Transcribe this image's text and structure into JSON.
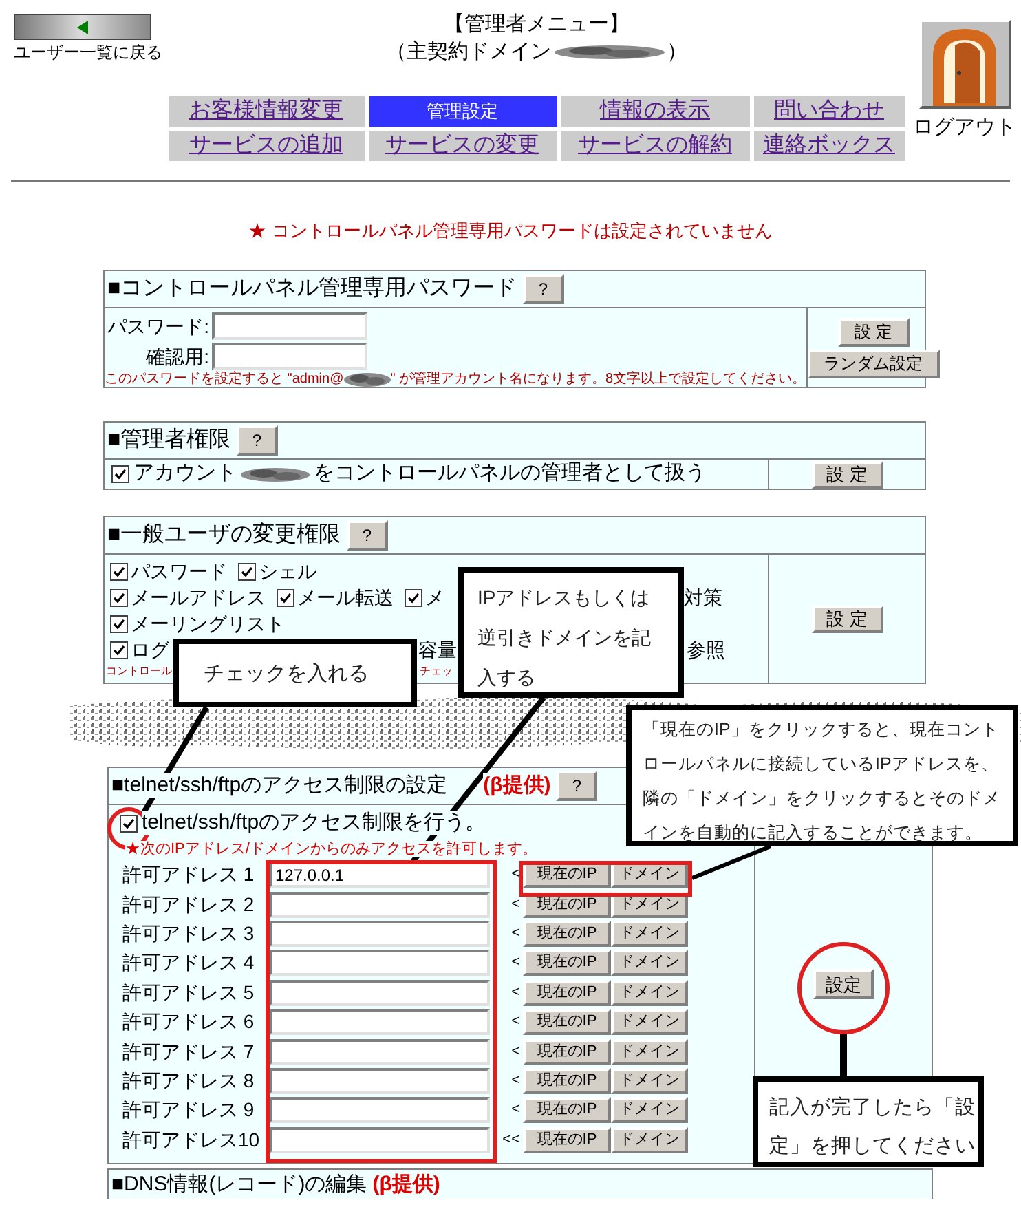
{
  "header": {
    "back_label": "ユーザー一覧に戻る",
    "title": "【管理者メニュー】",
    "subtitle_prefix": "（主契約ドメイン",
    "subtitle_suffix": "）",
    "logout_label": "ログアウト"
  },
  "nav": [
    {
      "label": "お客様情報変更",
      "selected": false
    },
    {
      "label": "管理設定",
      "selected": true
    },
    {
      "label": "情報の表示",
      "selected": false
    },
    {
      "label": "問い合わせ",
      "selected": false
    },
    {
      "label": "サービスの追加",
      "selected": false
    },
    {
      "label": "サービスの変更",
      "selected": false
    },
    {
      "label": "サービスの解約",
      "selected": false
    },
    {
      "label": "連絡ボックス",
      "selected": false
    }
  ],
  "notice": "★ コントロールパネル管理専用パスワードは設定されていません",
  "password_section": {
    "title": "■コントロールパネル管理専用パスワード",
    "help": "?",
    "fields": [
      {
        "label": "パスワード:"
      },
      {
        "label": "確認用:"
      }
    ],
    "note_prefix": "このパスワードを設定すると \"admin@",
    "note_suffix": "\" が管理アカウント名になります。8文字以上で設定してください。",
    "buttons": [
      "設 定",
      "ランダム設定"
    ]
  },
  "admin_section": {
    "title": "■管理者権限",
    "help": "?",
    "checked": true,
    "label_prefix": "アカウント",
    "label_suffix": "をコントロールパネルの管理者として扱う",
    "button": "設 定"
  },
  "user_section": {
    "title": "■一般ユーザの変更権限",
    "help": "?",
    "lines": [
      {
        "items": [
          {
            "kind": "checkbox",
            "label": "パスワード",
            "checked": true
          },
          {
            "kind": "checkbox",
            "label": "シェル",
            "checked": true
          }
        ]
      },
      {
        "items": [
          {
            "kind": "checkbox",
            "label": "メールアドレス",
            "checked": true
          },
          {
            "kind": "checkbox",
            "label": "メール転送",
            "checked": true
          },
          {
            "kind": "checkbox",
            "label": "メ",
            "checked": true
          },
          {
            "kind": "text",
            "label": "対策"
          }
        ]
      },
      {
        "items": [
          {
            "kind": "checkbox",
            "label": "メーリングリスト",
            "checked": true
          }
        ]
      },
      {
        "items": [
          {
            "kind": "checkbox",
            "label": "ログ",
            "checked": true
          },
          {
            "kind": "text",
            "label": "容量"
          },
          {
            "kind": "text",
            "label": "参照"
          }
        ]
      }
    ],
    "note": [
      {
        "text": "コントロール"
      },
      {
        "text": "チェッ"
      }
    ],
    "button": "設 定"
  },
  "access_section": {
    "title": "■telnet/ssh/ftpのアクセス制限の設定",
    "tag": "(β提供)",
    "help": "?",
    "enable": {
      "label": "telnet/ssh/ftpのアクセス制限を行う。",
      "checked": true
    },
    "note": "★次のIPアドレス/ドメインからのみアクセスを許可します。",
    "rows": [
      {
        "label": "許可アドレス 1",
        "value": "127.0.0.1",
        "arrow": "<",
        "ip_button": "現在のIP",
        "domain_button": "ドメイン"
      },
      {
        "label": "許可アドレス 2",
        "arrow": "<",
        "ip_button": "現在のIP",
        "domain_button": "ドメイン"
      },
      {
        "label": "許可アドレス 3",
        "arrow": "<",
        "ip_button": "現在のIP",
        "domain_button": "ドメイン"
      },
      {
        "label": "許可アドレス 4",
        "arrow": "<",
        "ip_button": "現在のIP",
        "domain_button": "ドメイン"
      },
      {
        "label": "許可アドレス 5",
        "arrow": "<",
        "ip_button": "現在のIP",
        "domain_button": "ドメイン"
      },
      {
        "label": "許可アドレス 6",
        "arrow": "<",
        "ip_button": "現在のIP",
        "domain_button": "ドメイン"
      },
      {
        "label": "許可アドレス 7",
        "arrow": "<",
        "ip_button": "現在のIP",
        "domain_button": "ドメイン"
      },
      {
        "label": "許可アドレス 8",
        "arrow": "<",
        "ip_button": "現在のIP",
        "domain_button": "ドメイン"
      },
      {
        "label": "許可アドレス 9",
        "arrow": "<",
        "ip_button": "現在のIP",
        "domain_button": "ドメイン"
      },
      {
        "label": "許可アドレス10",
        "arrow": "<<",
        "ip_button": "現在のIP",
        "domain_button": "ドメイン"
      }
    ],
    "button": "設定"
  },
  "dns_section": {
    "title": "■DNS情報(レコード)の編集",
    "tag": "(β提供)"
  },
  "callouts": [
    {
      "text": "チェックを入れる"
    },
    {
      "text": "IPアドレスもしくは逆引きドメインを記入する"
    },
    {
      "text": "「現在のIP」をクリックすると、現在コントロールパネルに接続しているIPアドレスを、隣の「ドメイン」をクリックするとそのドメインを自動的に記入することができます。"
    },
    {
      "text": "記入が完了したら「設定」を押してください"
    }
  ]
}
